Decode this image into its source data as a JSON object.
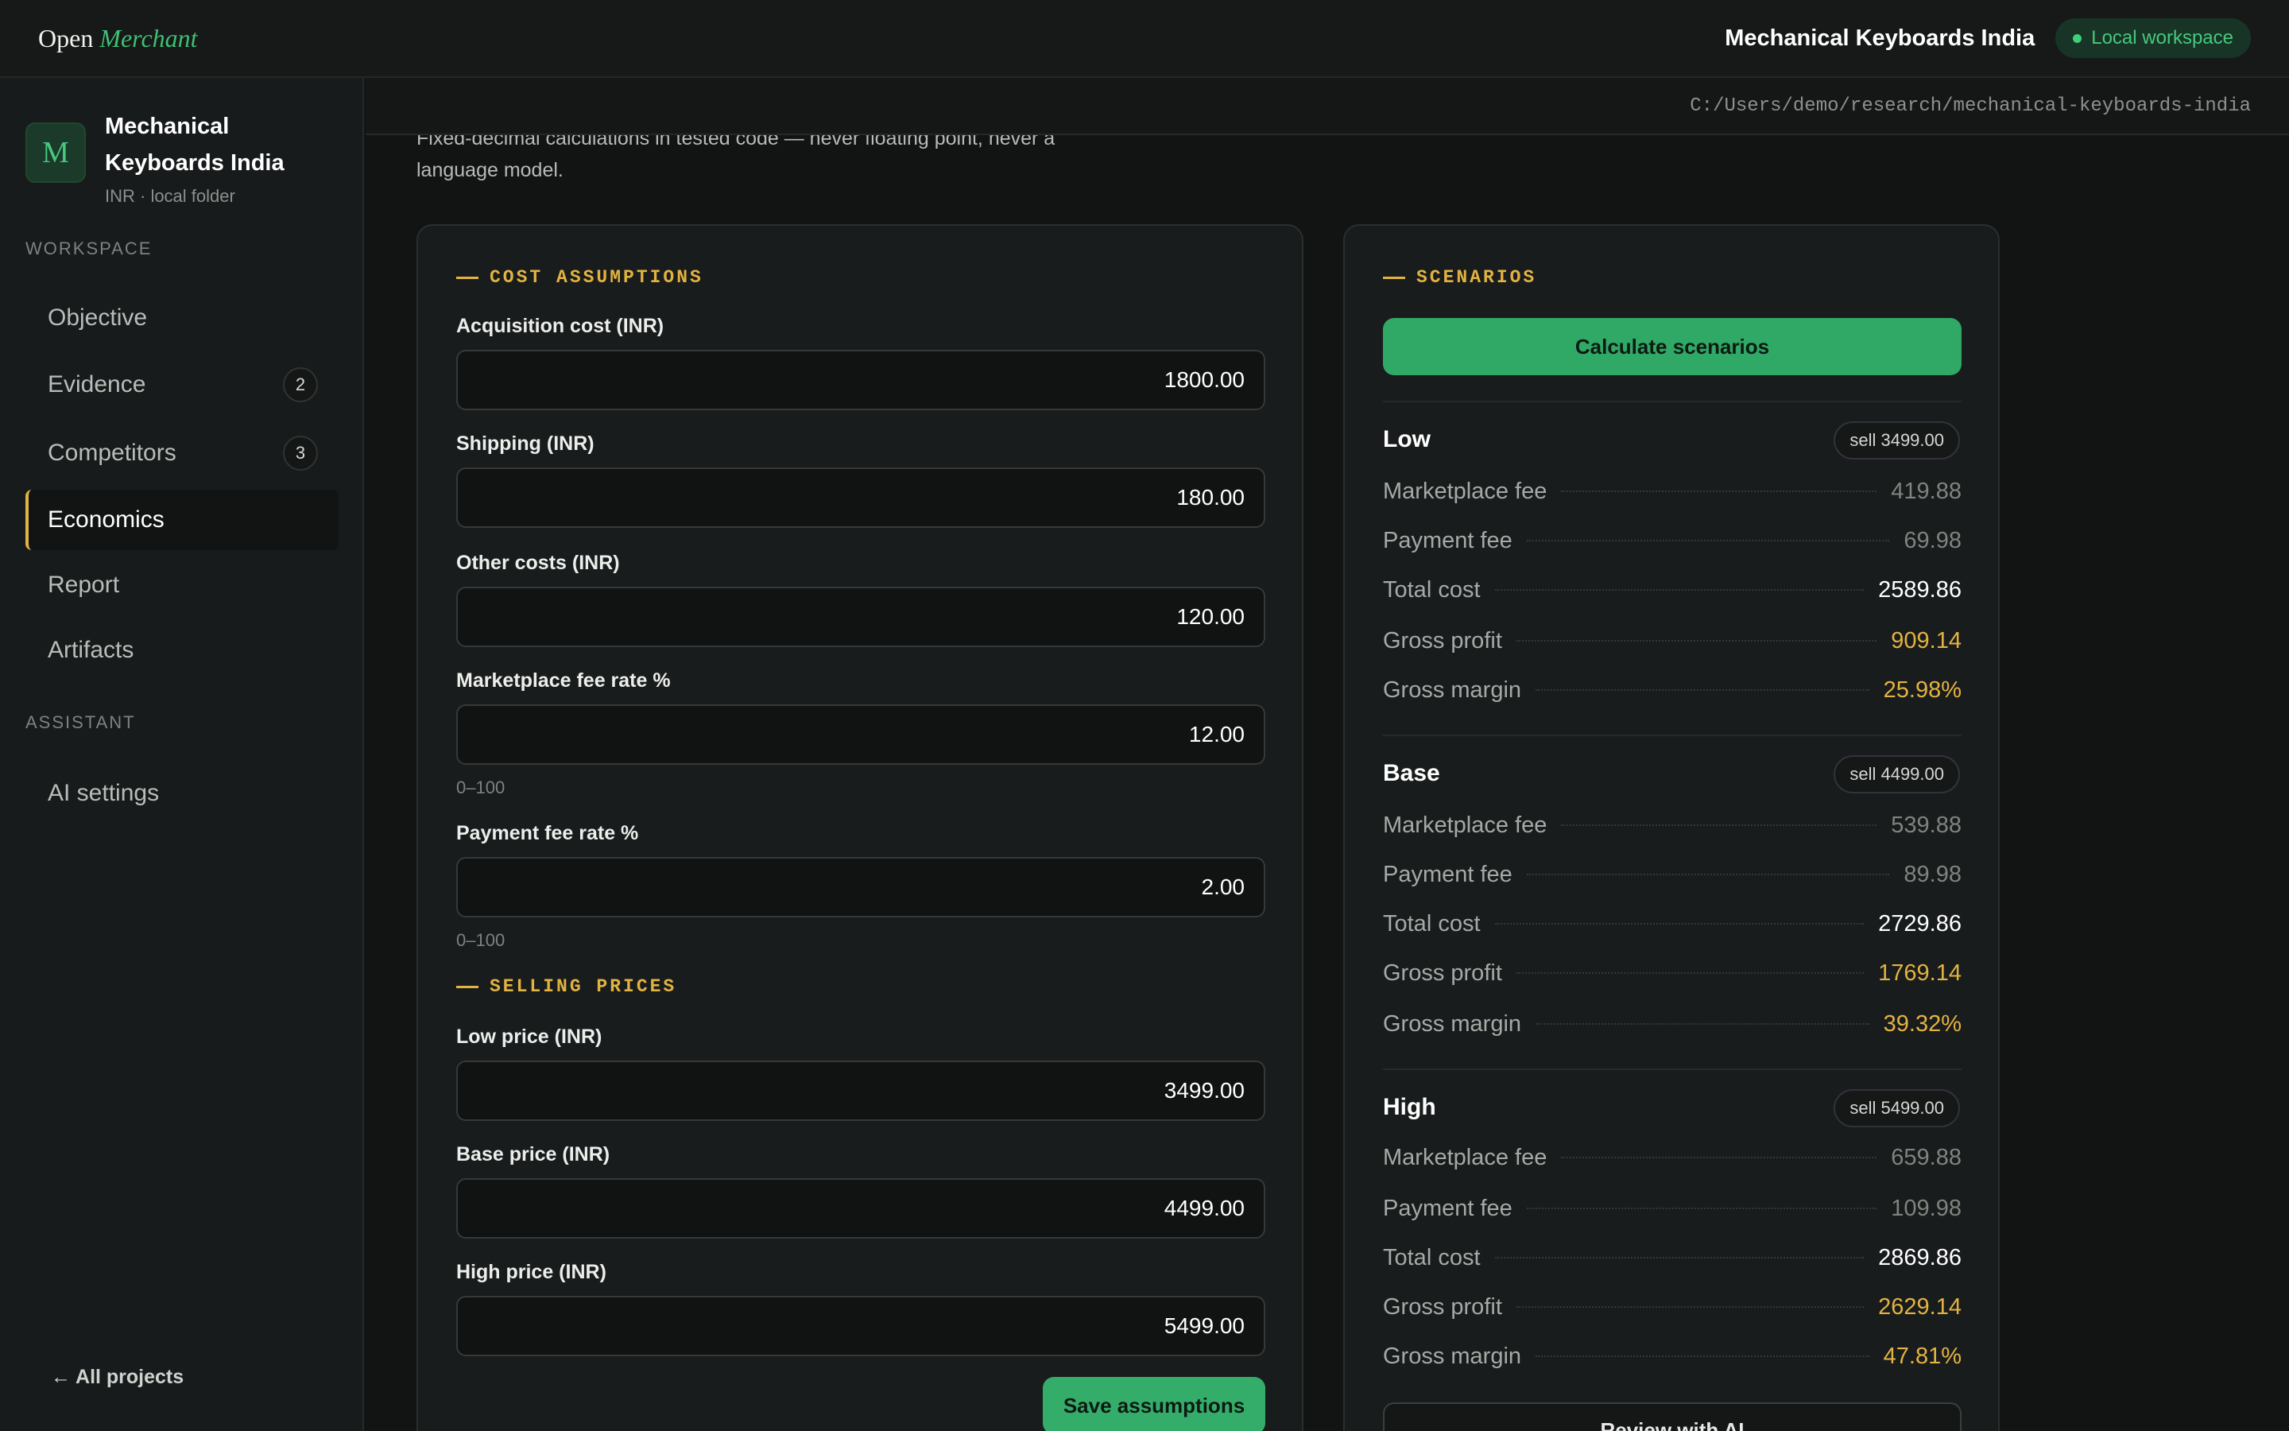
{
  "brand": {
    "part1": "Open",
    "part2": "Merchant"
  },
  "topbar": {
    "project": "Mechanical Keyboards India",
    "workspace_badge": "Local workspace"
  },
  "path": "C:/Users/demo/research/mechanical-keyboards-india",
  "sidebar": {
    "project_initial": "M",
    "project_name": "Mechanical Keyboards India",
    "project_sub": "INR · local folder",
    "workspace_label": "WORKSPACE",
    "items": [
      {
        "label": "Objective"
      },
      {
        "label": "Evidence",
        "count": "2"
      },
      {
        "label": "Competitors",
        "count": "3"
      },
      {
        "label": "Economics"
      },
      {
        "label": "Report"
      },
      {
        "label": "Artifacts"
      }
    ],
    "assistant_label": "ASSISTANT",
    "assistant_items": [
      {
        "label": "AI settings"
      }
    ],
    "all_projects": "← All projects"
  },
  "intro": "Fixed-decimal calculations in tested code — never floating point, never a language model.",
  "cost": {
    "title": "COST ASSUMPTIONS",
    "fields": [
      {
        "label": "Acquisition cost (INR)",
        "value": "1800.00"
      },
      {
        "label": "Shipping (INR)",
        "value": "180.00"
      },
      {
        "label": "Other costs (INR)",
        "value": "120.00"
      },
      {
        "label": "Marketplace fee rate %",
        "value": "12.00",
        "hint": "0–100"
      },
      {
        "label": "Payment fee rate %",
        "value": "2.00",
        "hint": "0–100"
      }
    ]
  },
  "prices": {
    "title": "SELLING PRICES",
    "fields": [
      {
        "label": "Low price (INR)",
        "value": "3499.00"
      },
      {
        "label": "Base price (INR)",
        "value": "4499.00"
      },
      {
        "label": "High price (INR)",
        "value": "5499.00"
      }
    ],
    "save_label": "Save assumptions"
  },
  "scenarios": {
    "title": "SCENARIOS",
    "calc_label": "Calculate scenarios",
    "review_label": "Review with AI",
    "row_labels": [
      "Marketplace fee",
      "Payment fee",
      "Total cost",
      "Gross profit",
      "Gross margin"
    ],
    "items": [
      {
        "name": "Low",
        "sell": "sell 3499.00",
        "values": [
          "419.88",
          "69.98",
          "2589.86",
          "909.14",
          "25.98%"
        ]
      },
      {
        "name": "Base",
        "sell": "sell 4499.00",
        "values": [
          "539.88",
          "89.98",
          "2729.86",
          "1769.14",
          "39.32%"
        ]
      },
      {
        "name": "High",
        "sell": "sell 5499.00",
        "values": [
          "659.88",
          "109.98",
          "2869.86",
          "2629.14",
          "47.81%"
        ]
      }
    ]
  },
  "colors": {
    "accent_green": "#35ad6a",
    "accent_gold": "#e3b341",
    "background": "#121414"
  }
}
